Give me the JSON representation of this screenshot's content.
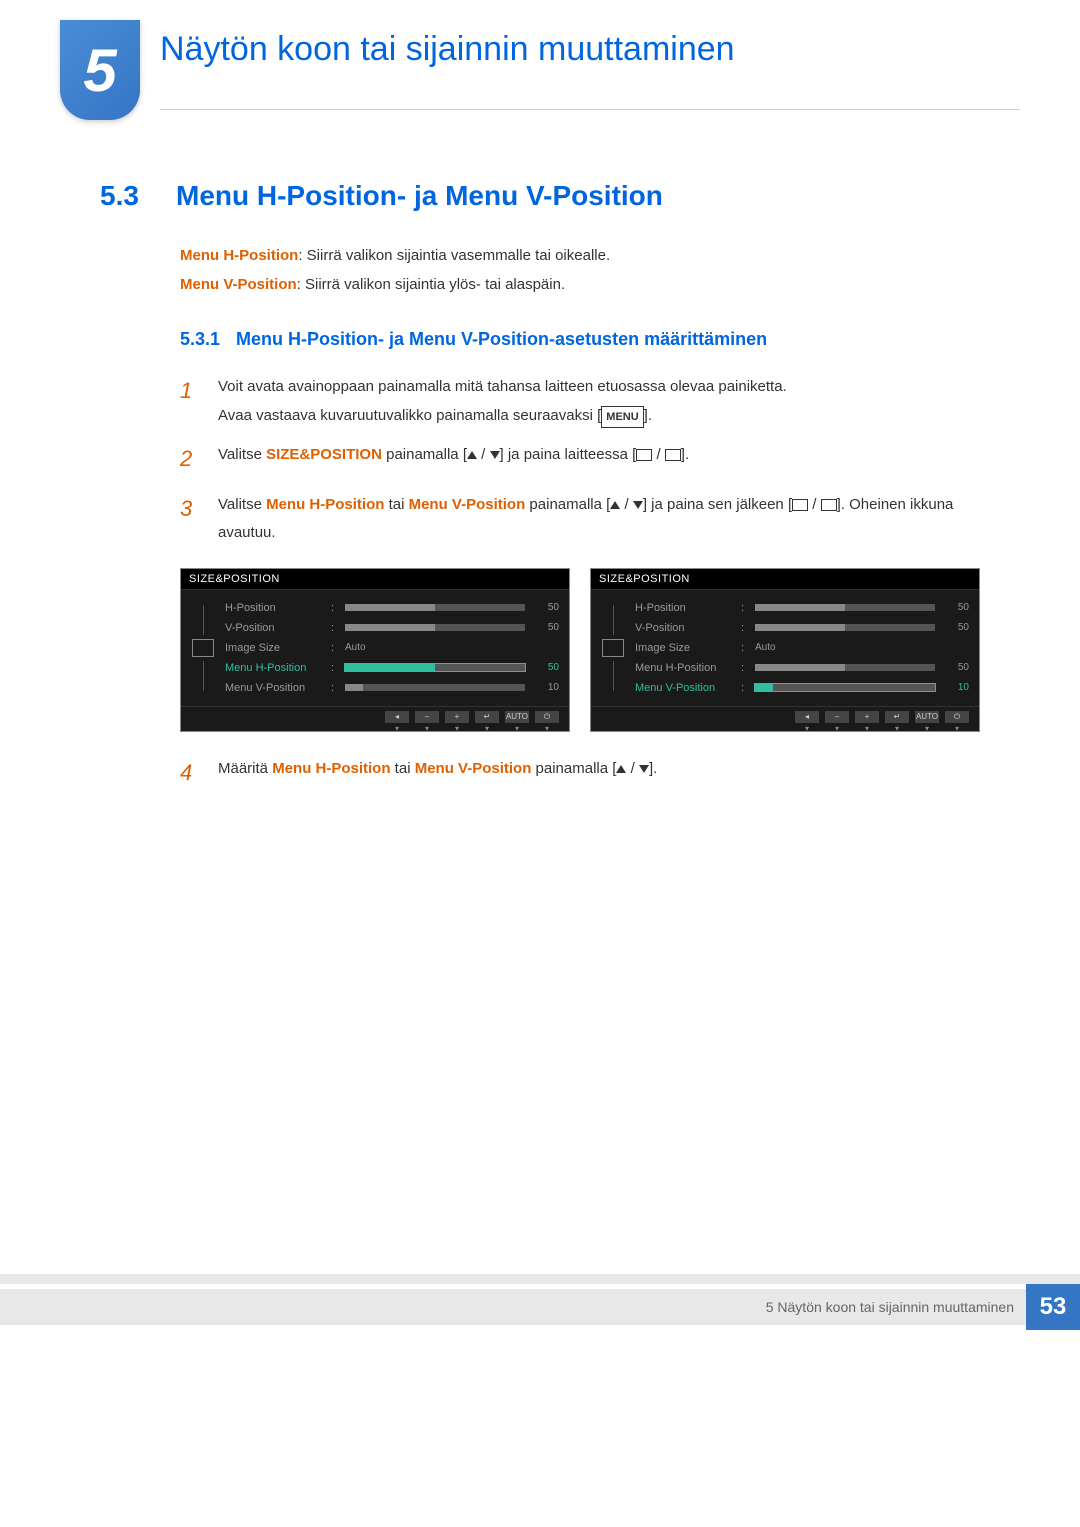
{
  "chapter": {
    "number": "5",
    "title": "Näytön koon tai sijainnin muuttaminen"
  },
  "section": {
    "number": "5.3",
    "title": "Menu H-Position- ja Menu V-Position"
  },
  "defs": {
    "hpos_label": "Menu H-Position",
    "hpos_text": ": Siirrä valikon sijaintia vasemmalle tai oikealle.",
    "vpos_label": "Menu V-Position",
    "vpos_text": ": Siirrä valikon sijaintia ylös- tai alaspäin."
  },
  "subsection": {
    "number": "5.3.1",
    "title": "Menu H-Position- ja Menu V-Position-asetusten määrittäminen"
  },
  "steps": {
    "s1a": "Voit avata avainoppaan painamalla mitä tahansa laitteen etuosassa olevaa painiketta.",
    "s1b_pre": "Avaa vastaava kuvaruutuvalikko painamalla seuraavaksi [",
    "s1b_menu": "MENU",
    "s1b_post": "].",
    "s2_pre": "Valitse ",
    "s2_hl": "SIZE&POSITION",
    "s2_mid": " painamalla [",
    "s2_mid2": "] ja paina laitteessa [",
    "s2_post": "].",
    "s3_pre": "Valitse ",
    "s3_hl1": "Menu H-Position",
    "s3_or": " tai ",
    "s3_hl2": "Menu V-Position",
    "s3_mid": " painamalla [",
    "s3_mid2": "] ja paina sen jälkeen [",
    "s3_post": "]. Oheinen ikkuna avautuu.",
    "s4_pre": "Määritä ",
    "s4_hl1": "Menu H-Position",
    "s4_or": " tai ",
    "s4_hl2": "Menu V-Position",
    "s4_mid": " painamalla [",
    "s4_post": "]."
  },
  "osd": {
    "title": "SIZE&POSITION",
    "items": {
      "hpos": "H-Position",
      "vpos": "V-Position",
      "imgsize": "Image Size",
      "menuh": "Menu H-Position",
      "menuv": "Menu V-Position"
    },
    "values": {
      "hpos": "50",
      "vpos": "50",
      "imgsize": "Auto",
      "menuh": "50",
      "menuv": "10"
    },
    "nav": {
      "back": "◂",
      "minus": "–",
      "plus": "+",
      "enter": "↵",
      "auto": "AUTO",
      "power": "⏻"
    }
  },
  "footer": {
    "text": "5 Näytön koon tai sijainnin muuttaminen",
    "page": "53"
  }
}
